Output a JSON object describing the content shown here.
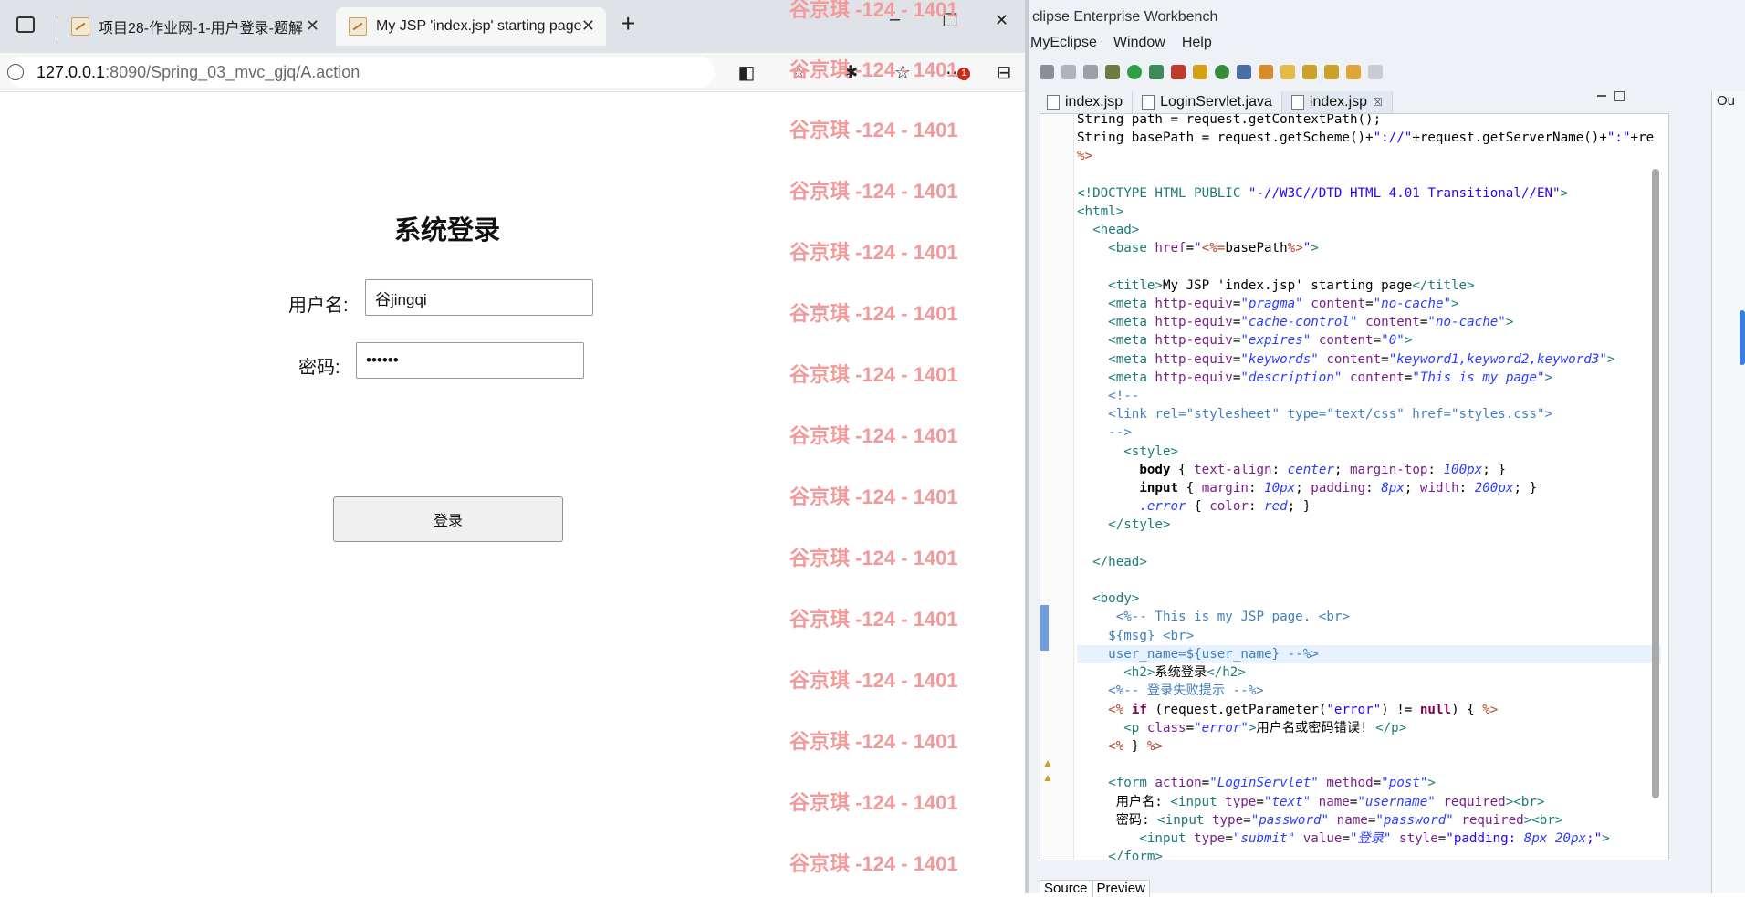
{
  "browser": {
    "tabs": [
      {
        "label": "项目28-作业网-1-用户登录-题解"
      },
      {
        "label": "My JSP 'index.jsp' starting page"
      }
    ],
    "new_tab": "+",
    "window_controls": {
      "minimize": "–",
      "maximize": "☐",
      "close": "✕"
    },
    "url": {
      "host": "127.0.0.1",
      "path": ":8090/Spring_03_mvc_gjq/A.action"
    },
    "notification_badge": "1"
  },
  "page": {
    "title": "系统登录",
    "username_label": "用户名:",
    "username_value": "谷jingqi",
    "password_label": "密码:",
    "password_value": "••••••",
    "submit_label": "登录"
  },
  "watermark": {
    "text": "谷京琪 -124 - 1401",
    "color": "#f29a9a"
  },
  "ide": {
    "title": "clipse Enterprise Workbench",
    "menu": [
      "MyEclipse",
      "Window",
      "Help"
    ],
    "editor_tabs": [
      {
        "label": "index.jsp",
        "active": false
      },
      {
        "label": "LoginServlet.java",
        "active": false
      },
      {
        "label": "index.jsp",
        "active": true
      }
    ],
    "active_tab_close": "☒",
    "bottom_tabs": [
      "Source",
      "Preview"
    ],
    "outline_label": "Ou"
  }
}
